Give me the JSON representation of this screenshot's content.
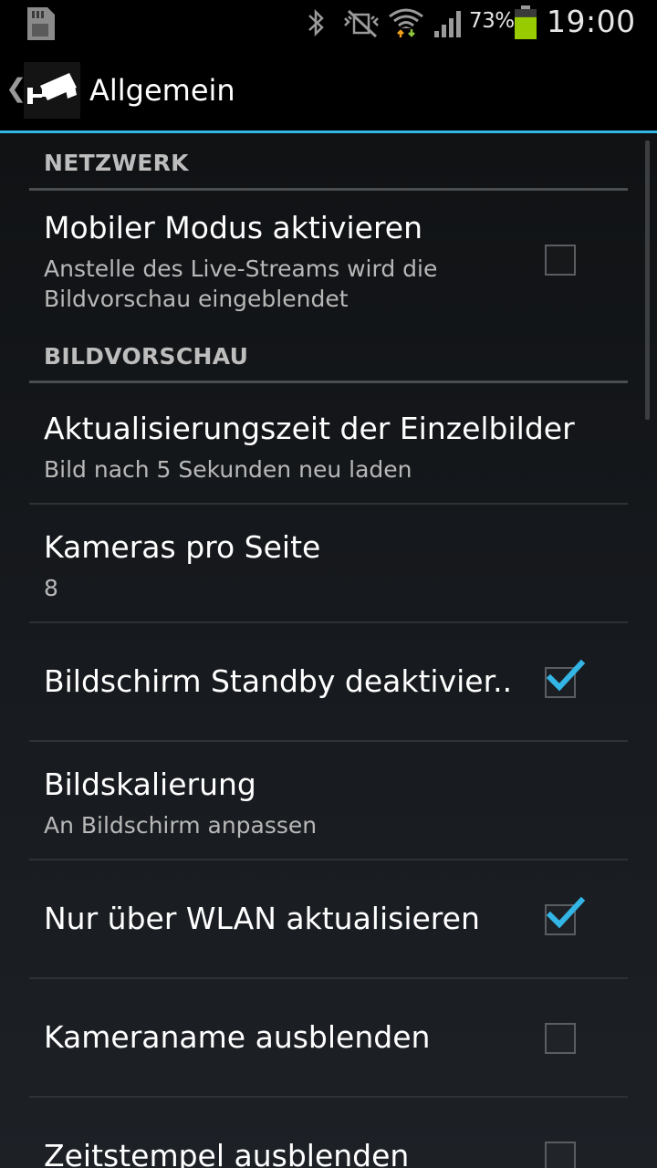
{
  "status_bar": {
    "battery_percent": "73%",
    "battery_level": 0.73,
    "time": "19:00",
    "icons": [
      "sd-card-icon",
      "bluetooth-icon",
      "vibrate-mute-icon",
      "wifi-icon",
      "signal-icon",
      "battery-icon"
    ]
  },
  "action_bar": {
    "title": "Allgemein",
    "up_glyph": "❮",
    "accent_color": "#33b5e5"
  },
  "categories": {
    "network": "NETZWERK",
    "preview": "BILDVORSCHAU"
  },
  "settings": {
    "mobile_mode": {
      "title": "Mobiler Modus aktivieren",
      "summary": "Anstelle des Live-Streams wird die Bildvorschau eingeblendet",
      "checked": false
    },
    "refresh_time": {
      "title": "Aktualisierungszeit der Einzelbilder",
      "summary": "Bild nach 5 Sekunden neu laden"
    },
    "cameras_per_page": {
      "title": "Kameras pro Seite",
      "summary": "8"
    },
    "disable_standby": {
      "title": "Bildschirm Standby deaktivier..",
      "checked": true
    },
    "scaling": {
      "title": "Bildskalierung",
      "summary": "An Bildschirm anpassen"
    },
    "wlan_only": {
      "title": "Nur über WLAN aktualisieren",
      "checked": true
    },
    "hide_camera_name": {
      "title": "Kameraname ausblenden",
      "checked": false
    },
    "hide_timestamp": {
      "title": "Zeitstempel ausblenden",
      "checked": false
    }
  }
}
